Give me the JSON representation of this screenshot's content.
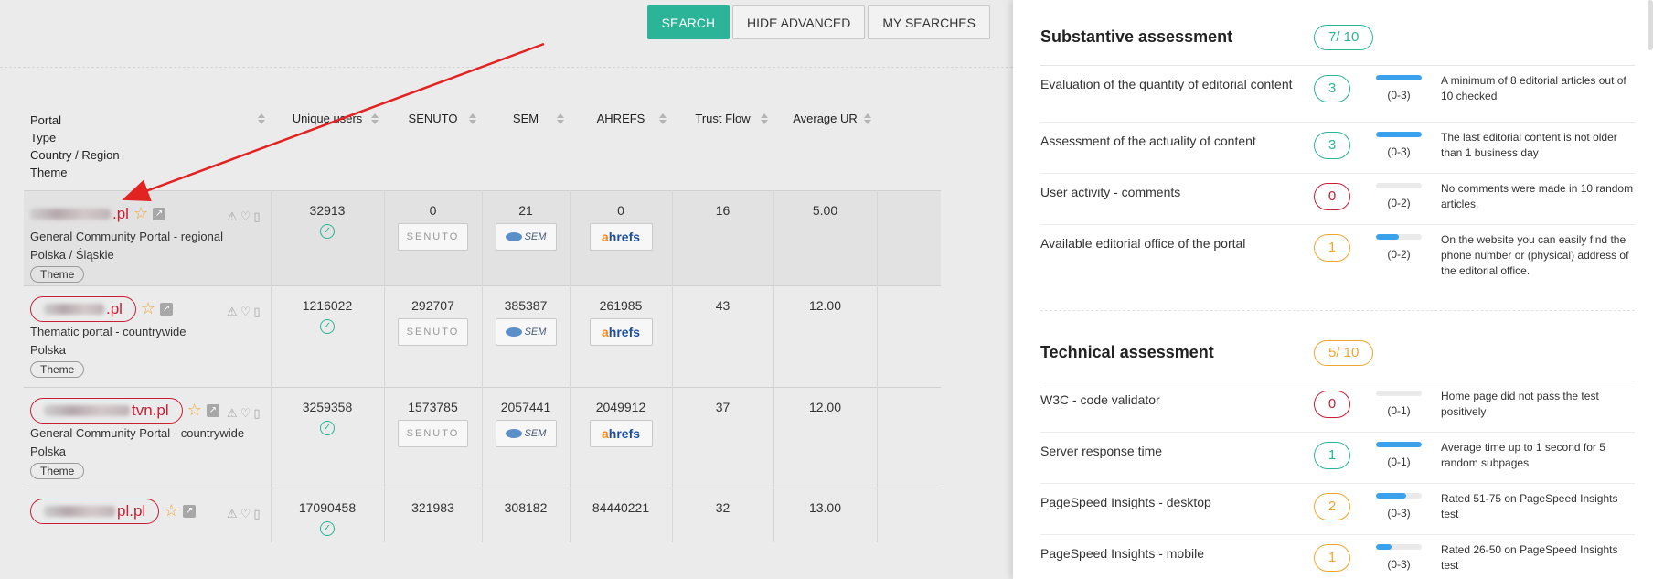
{
  "toolbar": {
    "search_label": "SEARCH",
    "hide_advanced_label": "HIDE ADVANCED",
    "my_searches_label": "MY SEARCHES"
  },
  "table": {
    "portal_header_lines": [
      "Portal",
      "Type",
      "Country / Region",
      "Theme"
    ],
    "columns": [
      {
        "key": "unique_users",
        "label": "Unique users"
      },
      {
        "key": "senuto",
        "label": "SENUTO"
      },
      {
        "key": "sem",
        "label": "SEM"
      },
      {
        "key": "ahrefs",
        "label": "AHREFS"
      },
      {
        "key": "trust_flow",
        "label": "Trust Flow"
      },
      {
        "key": "average_ur",
        "label": "Average UR"
      }
    ],
    "theme_label": "Theme",
    "senuto_logo_text": "SENUTO",
    "sem_logo_text": "SEM",
    "ahrefs_logo_a": "a",
    "ahrefs_logo_rest": "hrefs",
    "rows": [
      {
        "domain_suffix": ".pl",
        "type": "General Community Portal - regional",
        "region": "Polska / Śląskie",
        "unique_users": "32913",
        "senuto": "0",
        "sem": "21",
        "ahrefs": "0",
        "trust_flow": "16",
        "average_ur": "5.00",
        "verified": true,
        "outlined": false
      },
      {
        "domain_suffix": ".pl",
        "type": "Thematic portal - countrywide",
        "region": "Polska",
        "unique_users": "1216022",
        "senuto": "292707",
        "sem": "385387",
        "ahrefs": "261985",
        "trust_flow": "43",
        "average_ur": "12.00",
        "verified": true,
        "outlined": true
      },
      {
        "domain_suffix": "tvn.pl",
        "type": "General Community Portal - countrywide",
        "region": "Polska",
        "unique_users": "3259358",
        "senuto": "1573785",
        "sem": "2057441",
        "ahrefs": "2049912",
        "trust_flow": "37",
        "average_ur": "12.00",
        "verified": true,
        "outlined": true
      },
      {
        "domain_suffix": "pl.pl",
        "type": "",
        "region": "",
        "unique_users": "17090458",
        "senuto": "321983",
        "sem": "308182",
        "ahrefs": "84440221",
        "trust_flow": "32",
        "average_ur": "13.00",
        "verified": true,
        "outlined": true
      }
    ]
  },
  "panel": {
    "substantive": {
      "title": "Substantive assessment",
      "score": "7/ 10",
      "criteria": [
        {
          "label": "Evaluation of the quantity of editorial content",
          "score": "3",
          "max": 3,
          "range": "(0-3)",
          "status": "green",
          "note": "A minimum of 8 editorial articles out of 10 checked"
        },
        {
          "label": "Assessment of the actuality of content",
          "score": "3",
          "max": 3,
          "range": "(0-3)",
          "status": "green",
          "note": "The last editorial content is not older than 1 business day"
        },
        {
          "label": "User activity - comments",
          "score": "0",
          "max": 2,
          "range": "(0-2)",
          "status": "red",
          "note": "No comments were made in 10 random articles."
        },
        {
          "label": "Available editorial office of the portal",
          "score": "1",
          "max": 2,
          "range": "(0-2)",
          "status": "orange",
          "note": "On the website you can easily find the phone number or (physical) address of the editorial office."
        }
      ]
    },
    "technical": {
      "title": "Technical assessment",
      "score": "5/ 10",
      "criteria": [
        {
          "label": "W3C - code validator",
          "score": "0",
          "max": 1,
          "range": "(0-1)",
          "status": "red",
          "note": "Home page did not pass the test positively"
        },
        {
          "label": "Server response time",
          "score": "1",
          "max": 1,
          "range": "(0-1)",
          "status": "green",
          "note": "Average time up to 1 second for 5 random subpages"
        },
        {
          "label": "PageSpeed Insights - desktop",
          "score": "2",
          "max": 3,
          "range": "(0-3)",
          "status": "orange",
          "note": "Rated 51-75 on PageSpeed Insights test"
        },
        {
          "label": "PageSpeed Insights - mobile",
          "score": "1",
          "max": 3,
          "range": "(0-3)",
          "status": "orange",
          "note": "Rated 26-50 on PageSpeed Insights test"
        }
      ]
    }
  },
  "colors": {
    "accent_green": "#2bb498",
    "red": "#c71f36",
    "orange": "#f0a530",
    "bar_blue": "#3aa2ec"
  }
}
